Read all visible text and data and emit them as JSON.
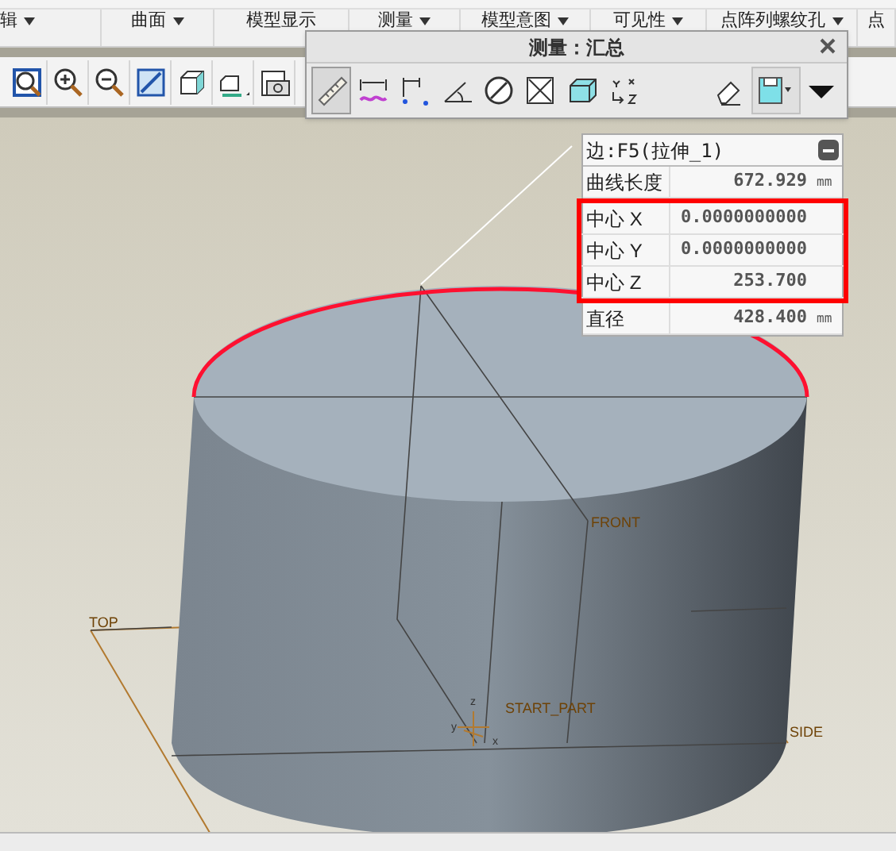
{
  "menu_tabs": [
    {
      "label": "辑",
      "dropdown": true
    },
    {
      "label": "曲面",
      "dropdown": true
    },
    {
      "label": "模型显示",
      "dropdown": false
    },
    {
      "label": "测量",
      "dropdown": true
    },
    {
      "label": "模型意图",
      "dropdown": true
    },
    {
      "label": "可见性",
      "dropdown": true
    },
    {
      "label": "点阵列螺纹孔",
      "dropdown": true
    },
    {
      "label": "点",
      "dropdown": false
    }
  ],
  "view_toolbar": [
    {
      "kind": "zoom-window"
    },
    {
      "kind": "zoom-in"
    },
    {
      "kind": "zoom-out"
    },
    {
      "kind": "repaint"
    },
    {
      "kind": "shaded"
    },
    {
      "kind": "view-manager"
    },
    {
      "kind": "camera"
    }
  ],
  "measure_dialog": {
    "title": "测量：汇总",
    "tools": [
      {
        "kind": "ruler",
        "selected": true
      },
      {
        "kind": "length",
        "selected": false
      },
      {
        "kind": "distance",
        "selected": false
      },
      {
        "kind": "angle",
        "selected": false
      },
      {
        "kind": "diameter",
        "selected": false
      },
      {
        "kind": "transform",
        "selected": false
      },
      {
        "kind": "volume",
        "selected": false
      },
      {
        "kind": "xyz",
        "selected": false
      },
      {
        "kind": "eraser",
        "selected": false
      },
      {
        "kind": "save",
        "selected": false
      },
      {
        "kind": "expand",
        "selected": false
      }
    ]
  },
  "info_panel": {
    "title": "边:F5(拉伸_1)",
    "rows": [
      {
        "label": "曲线长度",
        "value": "672.929",
        "unit": "mm",
        "highlighted": false
      },
      {
        "label": "中心 X",
        "value": "0.0000000000",
        "highlighted": true
      },
      {
        "label": "中心 Y",
        "value": "0.0000000000",
        "highlighted": true
      },
      {
        "label": "中心 Z",
        "value": "253.700",
        "highlighted": true
      },
      {
        "label": "直径",
        "value": "428.400",
        "unit": "mm",
        "highlighted": false
      }
    ]
  },
  "viewport": {
    "edge_selected": true,
    "datum_labels": [
      "FRONT",
      "TOP",
      "START_PART",
      "SIDE"
    ],
    "axis_labels": [
      "z",
      "y",
      "x"
    ]
  }
}
